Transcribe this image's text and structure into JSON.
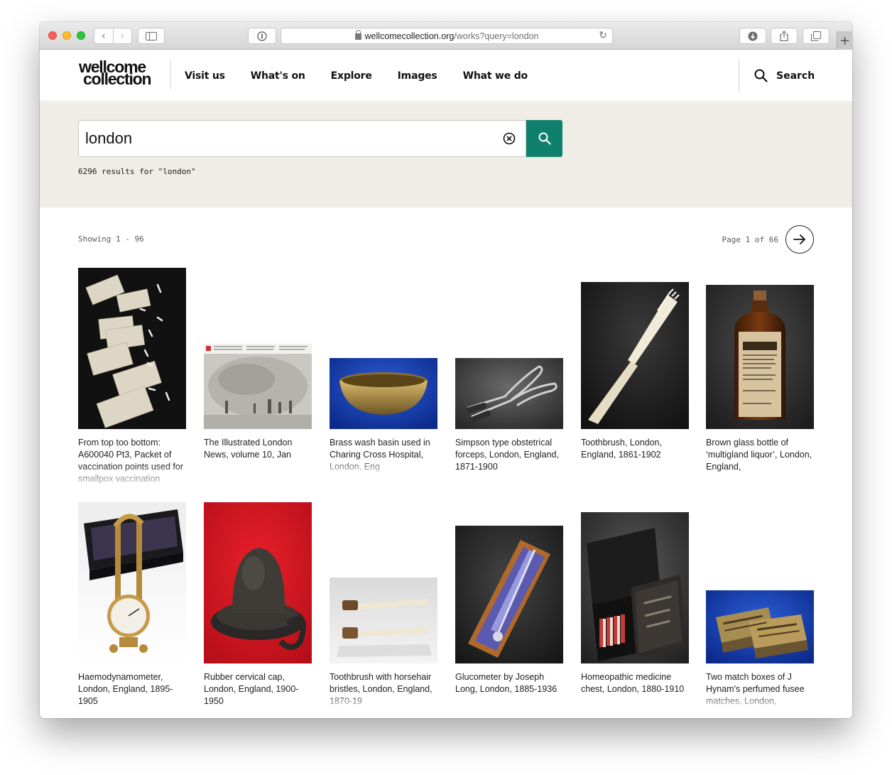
{
  "browser": {
    "url_host": "wellcomecollection.org",
    "url_path": "/works?query=london"
  },
  "header": {
    "logo_line1": "wellcome",
    "logo_line2": "collection",
    "nav": [
      {
        "label": "Visit us"
      },
      {
        "label": "What's on"
      },
      {
        "label": "Explore"
      },
      {
        "label": "Images"
      },
      {
        "label": "What we do"
      }
    ],
    "search_label": "Search"
  },
  "search": {
    "value": "london",
    "result_count": "6296 results for \"london\""
  },
  "results": {
    "showing": "Showing 1 - 96",
    "page": "Page 1 of 66"
  },
  "items": [
    {
      "caption": "From top too bottom: A600040 Pt3, Packet of vaccination points used for smallpox vaccination"
    },
    {
      "caption": "The Illustrated London News, volume 10, Jan"
    },
    {
      "caption": "Brass wash basin used in Charing Cross Hospital, London, Eng"
    },
    {
      "caption": "Simpson type obstetrical forceps, London, England, 1871-1900"
    },
    {
      "caption": "Toothbrush, London, England, 1861-1902"
    },
    {
      "caption": "Brown glass bottle of ‘multigland liquor’, London, England,"
    },
    {
      "caption": "Haemodynamometer, London, England, 1895-1905"
    },
    {
      "caption": "Rubber cervical cap, London, England, 1900-1950"
    },
    {
      "caption": "Toothbrush with horsehair bristles, London, England, 1870-19"
    },
    {
      "caption": "Glucometer by Joseph Long, London, 1885-1936"
    },
    {
      "caption": "Homeopathic medicine chest, London, 1880-1910"
    },
    {
      "caption": "Two match boxes of J Hynam's perfumed fusee matches, London,"
    }
  ],
  "colors": {
    "accent": "#0f806d",
    "nav_highlight": "#ffce3c",
    "band": "#efede5"
  }
}
